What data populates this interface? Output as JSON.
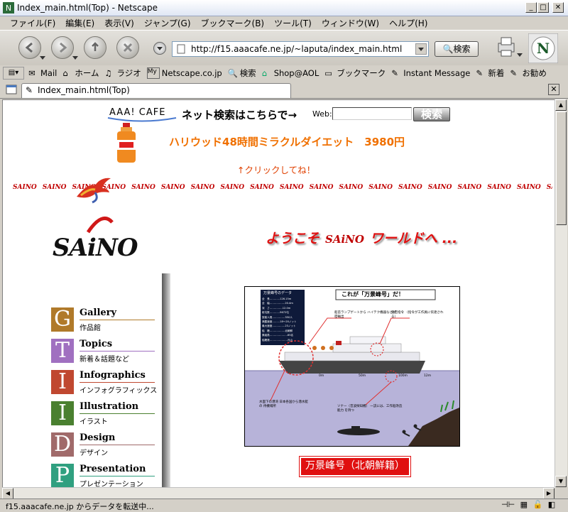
{
  "window": {
    "title": "Index_main.html(Top) - Netscape"
  },
  "menubar": {
    "items": [
      "ファイル(F)",
      "編集(E)",
      "表示(V)",
      "ジャンプ(G)",
      "ブックマーク(B)",
      "ツール(T)",
      "ウィンドウ(W)",
      "ヘルプ(H)"
    ]
  },
  "toolbar": {
    "url": "http://f15.aaacafe.ne.jp/~laputa/index_main.html",
    "search_label": "検索"
  },
  "personal_toolbar": {
    "items": [
      {
        "label": "Mail",
        "icon": "mail-icon"
      },
      {
        "label": "ホーム",
        "icon": "home-icon"
      },
      {
        "label": "ラジオ",
        "icon": "radio-icon"
      },
      {
        "label": "Netscape.co.jp",
        "icon": "my-netscape-icon"
      },
      {
        "label": "検索",
        "icon": "search-icon"
      },
      {
        "label": "Shop@AOL",
        "icon": "shop-icon"
      },
      {
        "label": "ブックマーク",
        "icon": "bookmark-icon"
      },
      {
        "label": "Instant Message",
        "icon": "link-icon"
      },
      {
        "label": "新着",
        "icon": "link-icon"
      },
      {
        "label": "お勧め",
        "icon": "link-icon"
      }
    ]
  },
  "tab": {
    "label": "Index_main.html(Top)"
  },
  "page": {
    "search_brand": "AAA! CAFE",
    "search_prompt": "ネット検索はこちらで→",
    "web_label": "Web:",
    "web_button": "検索",
    "ad_text": "ハリウッド48時間ミラクルダイエット　3980円",
    "click_text": "↑クリックしてね！",
    "banner_word": "SAINO",
    "logo_text": "SAiNO",
    "welcome_pre": "ようこそ",
    "welcome_brand": "SAiNO",
    "welcome_post": "ワールドへ ...",
    "nav": [
      {
        "letter": "G",
        "en": "Gallery",
        "jp": "作品館",
        "color": "#b07a2a"
      },
      {
        "letter": "T",
        "en": "Topics",
        "jp": "新着＆話題など",
        "color": "#a070c0"
      },
      {
        "letter": "I",
        "en": "Infographics",
        "jp": "インフォグラフィックス",
        "color": "#c04830"
      },
      {
        "letter": "I",
        "en": "Illustration",
        "jp": "イラスト",
        "color": "#4a8030"
      },
      {
        "letter": "D",
        "en": "Design",
        "jp": "デザイン",
        "color": "#a06a6a"
      },
      {
        "letter": "P",
        "en": "Presentation",
        "jp": "プレゼンテーション",
        "color": "#30a080"
      }
    ],
    "infographic": {
      "heading": "これが「万景峰号」だ！",
      "data_title": "万景峰号のデータ",
      "data_rows": [
        "全　長…………126.15m",
        "全　幅………………20.4m",
        "深　さ……………12.0m",
        "総屯数…………9672屯",
        "旅客人員……………350人",
        "満載速度………18〜20ノット",
        "最大速度……………23ノット",
        "船　籍………………北朝鮮",
        "乗組員…………………85名",
        "船籍港…………………元山"
      ],
      "callout_1": "船首ランプゲートから ハイテク機器などが密輸出",
      "callout_2": "秘密指令 （指令が工作員に伝達される）",
      "callout_3": "水面下の港湾 日本各国から潜水艇の 待機場所",
      "callout_4": "ソナー（音波探知機） 一説には、工作船改造能力 を持つ",
      "depth_1": "0m",
      "depth_2": "50m",
      "depth_3": "100m",
      "depth_4": "12m"
    },
    "caption": "万景峰号（北朝鮮籍）"
  },
  "status": {
    "text": "f15.aaacafe.ne.jp からデータを転送中..."
  }
}
